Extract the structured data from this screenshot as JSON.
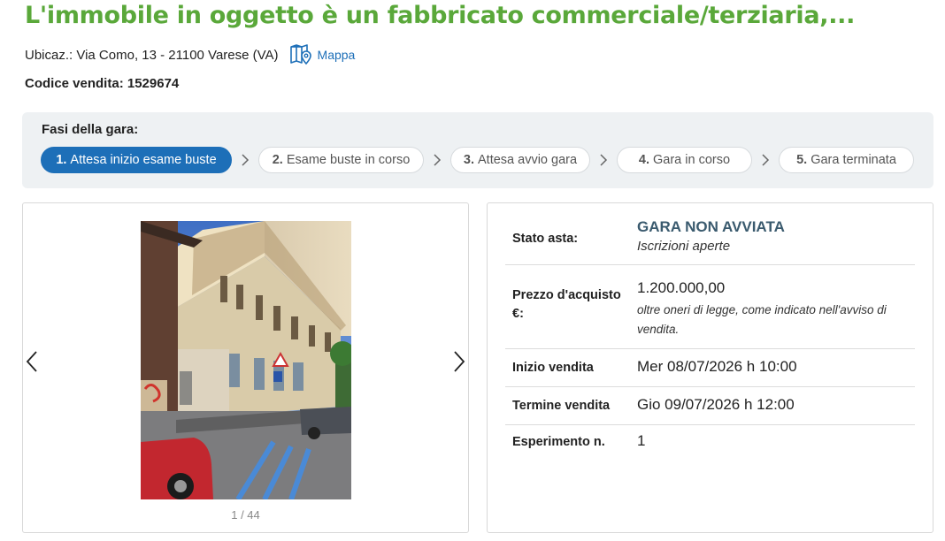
{
  "listing": {
    "title": "L'immobile in oggetto è un fabbricato commerciale/terziaria,...",
    "location": "Ubicaz.: Via Como, 13 - 21100 Varese (VA)",
    "map_label": "Mappa",
    "code": "Codice vendita: 1529674"
  },
  "phases": {
    "label": "Fasi della gara:",
    "steps": [
      {
        "num": "1.",
        "label": "Attesa inizio esame buste"
      },
      {
        "num": "2.",
        "label": "Esame buste in corso"
      },
      {
        "num": "3.",
        "label": "Attesa avvio gara"
      },
      {
        "num": "4.",
        "label": "Gara in corso"
      },
      {
        "num": "5.",
        "label": "Gara terminata"
      }
    ],
    "active_index": 0
  },
  "gallery": {
    "counter": "1 / 44"
  },
  "details": {
    "stato_label": "Stato asta:",
    "stato_value": "GARA NON AVVIATA",
    "stato_sub": "Iscrizioni aperte",
    "prezzo_label": "Prezzo d'acquisto €:",
    "prezzo_value": "1.200.000,00",
    "prezzo_note": "oltre oneri di legge, come indicato nell'avviso di vendita.",
    "inizio_label": "Inizio vendita",
    "inizio_value": "Mer 08/07/2026 h 10:00",
    "termine_label": "Termine vendita",
    "termine_value": "Gio 09/07/2026 h 12:00",
    "esperimento_label": "Esperimento n.",
    "esperimento_value": "1"
  },
  "colors": {
    "title_green": "#5aa83a",
    "accent_blue": "#1d6fb8",
    "status_slate": "#3a5a6e"
  }
}
